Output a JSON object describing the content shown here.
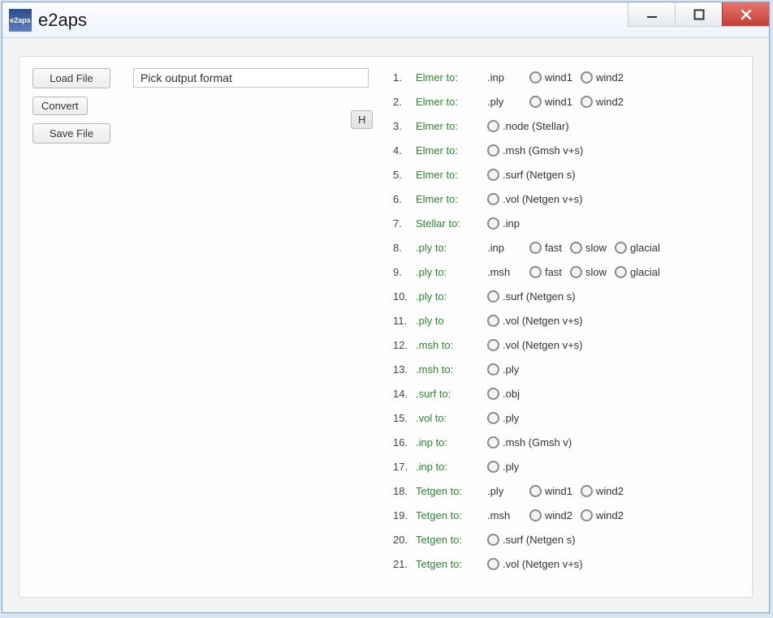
{
  "window": {
    "icon_text": "e2aps",
    "title": "e2aps"
  },
  "buttons": {
    "load_file": "Load File",
    "convert": "Convert",
    "save_file": "Save File",
    "h": "H"
  },
  "format_input": {
    "value": "Pick output format"
  },
  "rows": [
    {
      "n": "1.",
      "label": "Elmer to:",
      "ext": ".inp",
      "ext_has_radio": false,
      "opts": [
        "wind1",
        "wind2"
      ]
    },
    {
      "n": "2.",
      "label": "Elmer to:",
      "ext": ".ply",
      "ext_has_radio": false,
      "opts": [
        "wind1",
        "wind2"
      ]
    },
    {
      "n": "3.",
      "label": "Elmer to:",
      "ext": "",
      "ext_has_radio": false,
      "opts_radio": [
        ".node (Stellar)"
      ]
    },
    {
      "n": "4.",
      "label": "Elmer to:",
      "ext": "",
      "ext_has_radio": false,
      "opts_radio": [
        ".msh (Gmsh v+s)"
      ]
    },
    {
      "n": "5.",
      "label": "Elmer to:",
      "ext": "",
      "ext_has_radio": false,
      "opts_radio": [
        ".surf (Netgen s)"
      ]
    },
    {
      "n": "6.",
      "label": "Elmer to:",
      "ext": "",
      "ext_has_radio": false,
      "opts_radio": [
        ".vol (Netgen v+s)"
      ]
    },
    {
      "n": "7.",
      "label": "Stellar to:",
      "ext": "",
      "ext_has_radio": false,
      "opts_radio": [
        ".inp"
      ]
    },
    {
      "n": "8.",
      "label": ".ply to:",
      "ext": ".inp",
      "ext_has_radio": false,
      "opts": [
        "fast",
        "slow",
        "glacial"
      ]
    },
    {
      "n": "9.",
      "label": ".ply to:",
      "ext": ".msh",
      "ext_has_radio": false,
      "opts": [
        "fast",
        "slow",
        "glacial"
      ]
    },
    {
      "n": "10.",
      "label": ".ply to:",
      "ext": "",
      "ext_has_radio": false,
      "opts_radio": [
        ".surf (Netgen s)"
      ]
    },
    {
      "n": "11.",
      "label": ".ply to",
      "ext": "",
      "ext_has_radio": false,
      "opts_radio": [
        ".vol (Netgen v+s)"
      ]
    },
    {
      "n": "12.",
      "label": ".msh to:",
      "ext": "",
      "ext_has_radio": false,
      "opts_radio": [
        ".vol (Netgen v+s)"
      ]
    },
    {
      "n": "13.",
      "label": ".msh to:",
      "ext": "",
      "ext_has_radio": false,
      "opts_radio": [
        ".ply"
      ]
    },
    {
      "n": "14.",
      "label": ".surf to:",
      "ext": "",
      "ext_has_radio": false,
      "opts_radio": [
        ".obj"
      ]
    },
    {
      "n": "15.",
      "label": ".vol to:",
      "ext": "",
      "ext_has_radio": false,
      "opts_radio": [
        ".ply"
      ]
    },
    {
      "n": "16.",
      "label": ".inp to:",
      "ext": "",
      "ext_has_radio": false,
      "opts_radio": [
        ".msh (Gmsh v)"
      ]
    },
    {
      "n": "17.",
      "label": ".inp to:",
      "ext": "",
      "ext_has_radio": false,
      "opts_radio": [
        ".ply"
      ]
    },
    {
      "n": "18.",
      "label": "Tetgen to:",
      "ext": ".ply",
      "ext_has_radio": false,
      "opts": [
        "wind1",
        "wind2"
      ]
    },
    {
      "n": "19.",
      "label": "Tetgen to:",
      "ext": ".msh",
      "ext_has_radio": false,
      "opts": [
        "wind2",
        "wind2"
      ]
    },
    {
      "n": "20.",
      "label": "Tetgen to:",
      "ext": "",
      "ext_has_radio": false,
      "opts_radio": [
        ".surf (Netgen s)"
      ]
    },
    {
      "n": "21.",
      "label": "Tetgen to:",
      "ext": "",
      "ext_has_radio": false,
      "opts_radio": [
        ".vol (Netgen v+s)"
      ]
    }
  ]
}
